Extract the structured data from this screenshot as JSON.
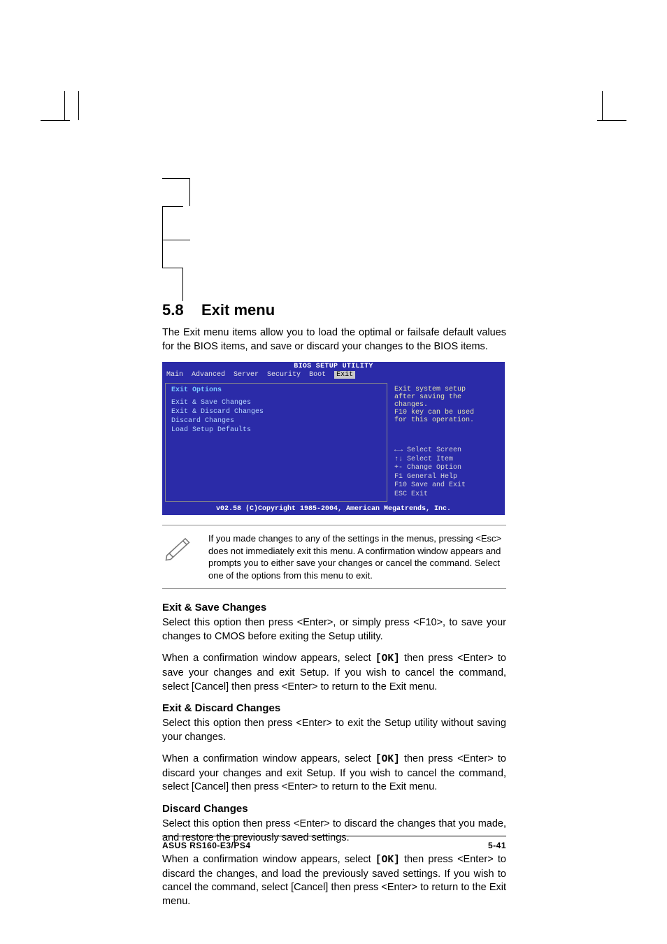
{
  "heading": {
    "num": "5.8",
    "title": "Exit menu"
  },
  "intro": "The Exit menu items allow you to load the optimal or failsafe default values for the BIOS items, and save or discard your changes to the BIOS items.",
  "bios": {
    "title": "BIOS SETUP UTILITY",
    "tabs": [
      "Main",
      "Advanced",
      "Server",
      "Security",
      "Boot",
      "Exit"
    ],
    "active_tab": "Exit",
    "left_header": "Exit Options",
    "left_items": [
      "Exit & Save Changes",
      "Exit & Discard Changes",
      "Discard Changes",
      "",
      "Load Setup Defaults"
    ],
    "right_help_top": [
      "Exit system setup",
      "after saving the",
      "changes.",
      "",
      "F10 key can be used",
      "for this operation."
    ],
    "right_help_bot": [
      "←→ Select Screen",
      "↑↓  Select Item",
      "+-  Change Option",
      "F1  General Help",
      "F10 Save and Exit",
      "ESC Exit"
    ],
    "footer": "v02.58 (C)Copyright 1985-2004, American Megatrends, Inc."
  },
  "note": "If you made changes to any of the settings in the menus, pressing <Esc> does not immediately exit this menu. A confirmation window appears and prompts you to either save your changes or cancel the command. Select one of the options from this menu to exit.",
  "sections": {
    "s1": {
      "title": "Exit & Save Changes",
      "p1": "Select this option then press <Enter>, or simply press <F10>, to save your changes to CMOS before exiting the Setup utility.",
      "p2a": "When a confirmation window appears, select ",
      "p2b": "[OK]",
      "p2c": " then press <Enter> to save your changes and exit Setup. If you wish to cancel the command, select [Cancel] then press <Enter> to return to the Exit menu."
    },
    "s2": {
      "title": "Exit & Discard Changes",
      "p1": "Select this option then press <Enter> to exit the Setup utility without saving your changes.",
      "p2a": "When a confirmation window appears, select ",
      "p2b": "[OK]",
      "p2c": " then press <Enter> to discard your changes and exit Setup. If you wish to cancel the command, select [Cancel] then press <Enter> to return to the Exit menu."
    },
    "s3": {
      "title": "Discard Changes",
      "p1": "Select this option then press <Enter> to discard the changes that you made, and restore the previously saved settings.",
      "p2a": "When a confirmation window appears, select ",
      "p2b": "[OK]",
      "p2c": " then press <Enter> to discard the changes, and load the previously saved settings. If you wish to cancel the command, select [Cancel] then press <Enter> to return to the Exit menu."
    }
  },
  "footer": {
    "left": "ASUS RS160-E3/PS4",
    "right": "5-41"
  }
}
